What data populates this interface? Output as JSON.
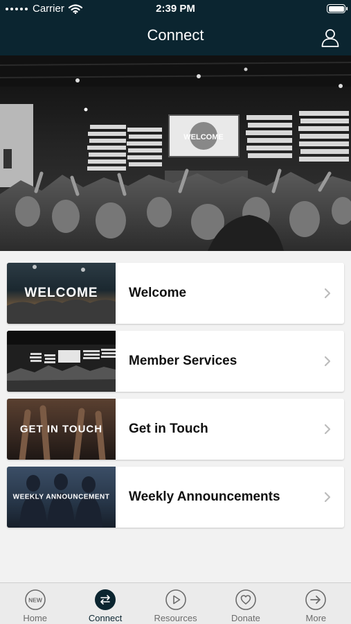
{
  "status_bar": {
    "carrier": "Carrier",
    "time": "2:39 PM"
  },
  "nav": {
    "title": "Connect",
    "profile_icon": "person-icon"
  },
  "hero": {
    "screen_text": "WELCOME"
  },
  "cards": [
    {
      "title": "Welcome",
      "thumb_label": "WELCOME"
    },
    {
      "title": "Member Services",
      "thumb_label": ""
    },
    {
      "title": "Get in Touch",
      "thumb_label": "GET IN TOUCH"
    },
    {
      "title": "Weekly Announcements",
      "thumb_label": "WEEKLY ANNOUNCEMENT"
    }
  ],
  "tabs": [
    {
      "label": "Home",
      "icon": "new-badge-icon",
      "icon_text": "NEW"
    },
    {
      "label": "Connect",
      "icon": "swap-arrows-icon",
      "active": true
    },
    {
      "label": "Resources",
      "icon": "play-circle-icon"
    },
    {
      "label": "Donate",
      "icon": "heart-circle-icon"
    },
    {
      "label": "More",
      "icon": "arrow-right-circle-icon"
    }
  ],
  "colors": {
    "nav_bg": "#0b2530",
    "background": "#f2f2f2",
    "tab_active": "#0b2530",
    "tab_inactive": "#6b6b6b"
  }
}
